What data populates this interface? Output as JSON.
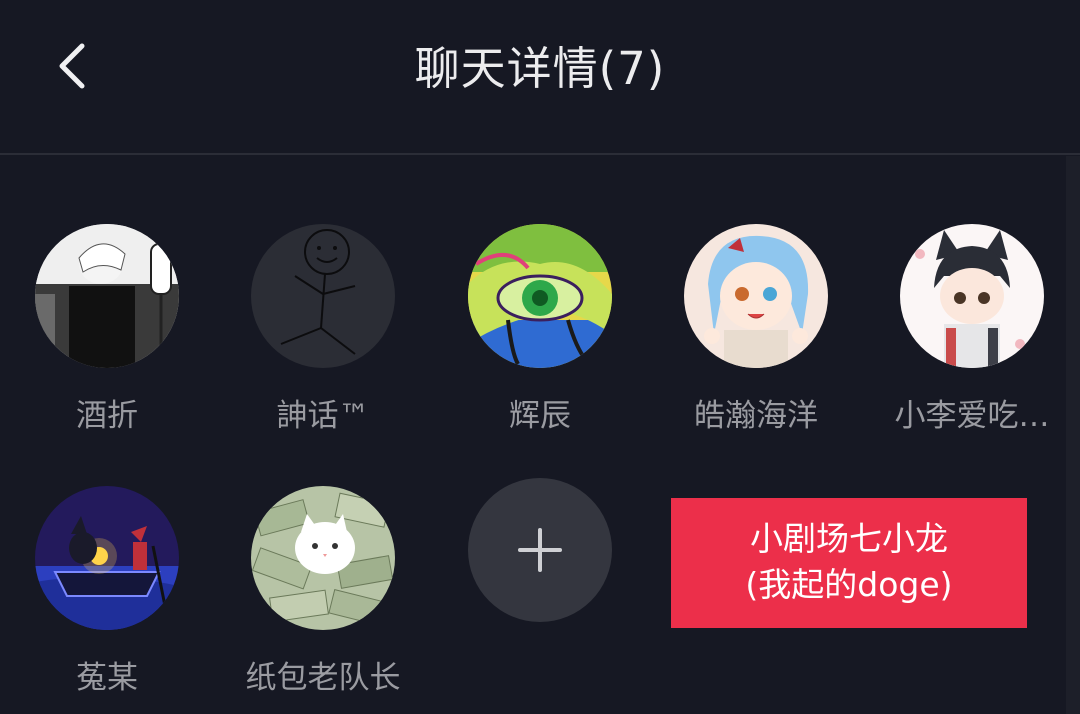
{
  "header": {
    "title": "聊天详情(7)",
    "back_icon": "chevron-left-icon"
  },
  "members": [
    {
      "name": "酒折",
      "avatar": "anime-portrait-bw"
    },
    {
      "name": "訷话™",
      "avatar": "stick-figure-drawing"
    },
    {
      "name": "辉辰",
      "avatar": "colorful-eye-painting"
    },
    {
      "name": "皓瀚海洋",
      "avatar": "anime-girl-blue-hair"
    },
    {
      "name": "小李爱吃…",
      "avatar": "anime-boy-cat-ears"
    },
    {
      "name": "菟某",
      "avatar": "night-boat-illustration"
    },
    {
      "name": "纸包老队长",
      "avatar": "cat-on-money"
    }
  ],
  "add_member": {
    "icon": "plus-icon"
  },
  "overlay_caption": {
    "line1": "小剧场七小龙",
    "line2": "(我起的doge)"
  },
  "colors": {
    "background": "#161823",
    "caption_bg": "#ec2f4a",
    "name_text": "#9a9ba1"
  }
}
